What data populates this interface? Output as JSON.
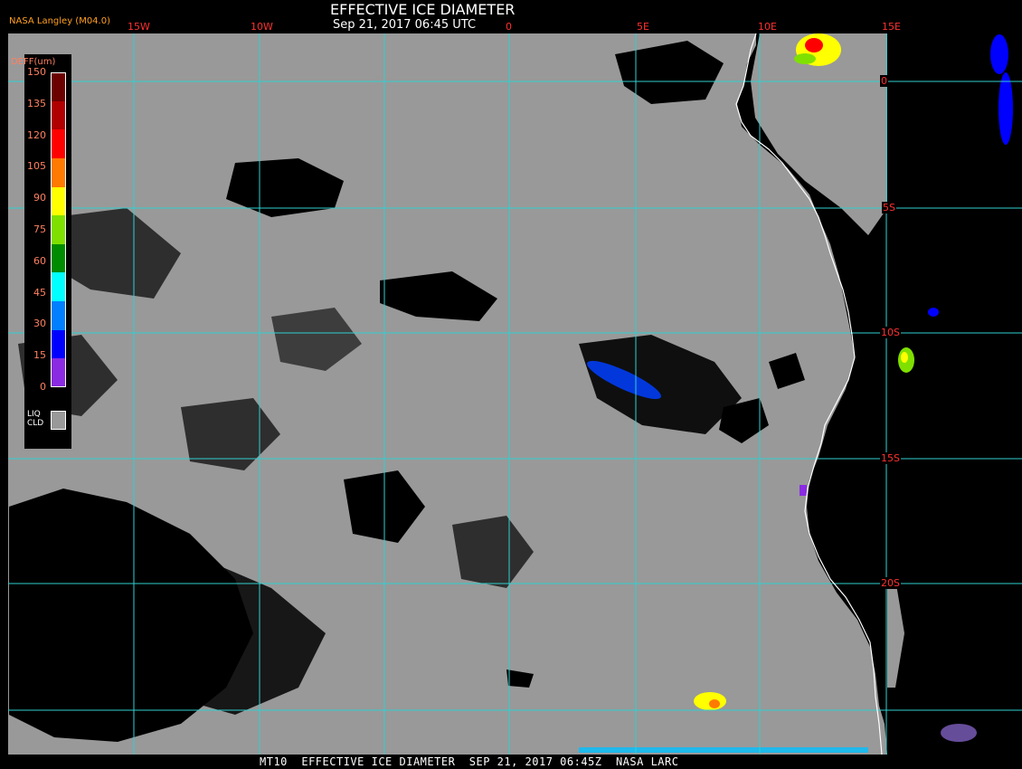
{
  "header": {
    "title": "EFFECTIVE ICE DIAMETER",
    "datetime": "Sep 21, 2017 06:45 UTC",
    "credit": "NASA Langley (M04.0)"
  },
  "footer": {
    "text": "MT10  EFFECTIVE ICE DIAMETER  SEP 21, 2017 06:45Z  NASA LARC"
  },
  "longitude_labels": [
    "15W",
    "10W",
    "0",
    "5E",
    "10E",
    "15E"
  ],
  "latitude_labels": [
    "0",
    "5S",
    "10S",
    "15S",
    "20S"
  ],
  "legend": {
    "title": "DEFF(um)",
    "ticks": [
      "150",
      "135",
      "120",
      "105",
      "90",
      "75",
      "60",
      "45",
      "30",
      "15",
      "0"
    ],
    "colors": [
      "#6b0000",
      "#b00000",
      "#ff0000",
      "#ff7a00",
      "#ffff00",
      "#7fe000",
      "#008c00",
      "#00ffff",
      "#0080ff",
      "#0000ff",
      "#8a2be2"
    ],
    "liq_label_1": "LIQ",
    "liq_label_2": "CLD",
    "liq_color": "#999999"
  },
  "colors": {
    "liquid_cloud": "#999999",
    "clear": "#000000",
    "grid": "#30d0d0",
    "coastline": "#ffffff"
  }
}
